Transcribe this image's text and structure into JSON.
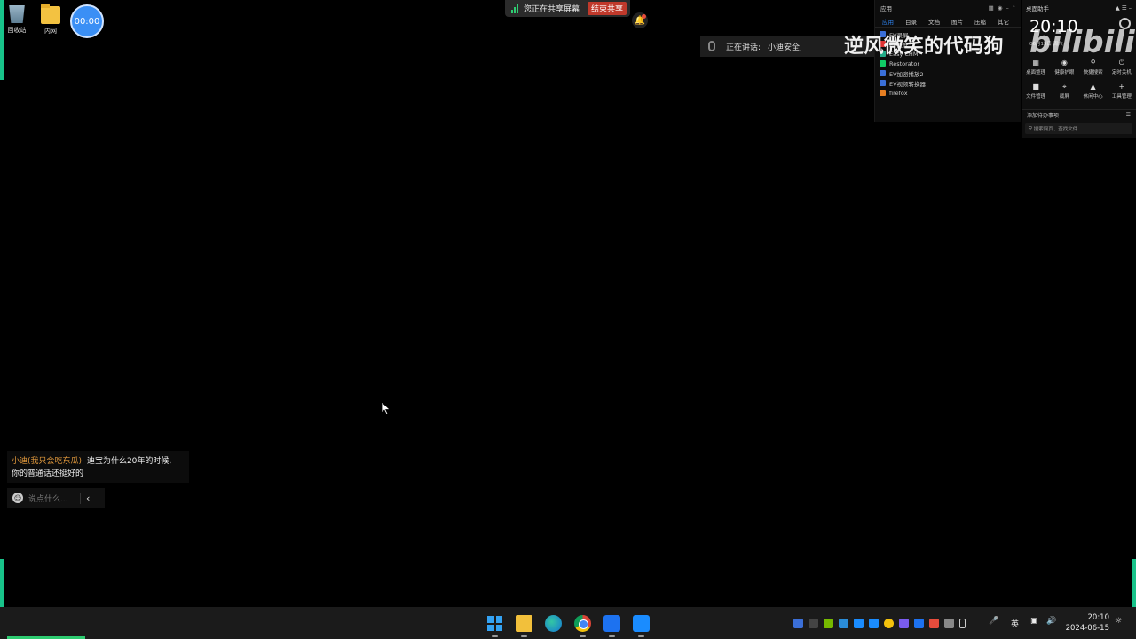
{
  "desktop": {
    "icons": [
      {
        "label": "回收站",
        "icon": "recycle-bin-icon"
      },
      {
        "label": "内网",
        "icon": "folder-icon"
      }
    ],
    "timer": "00:00"
  },
  "share_bar": {
    "status": "您正在共享屏幕",
    "stop_label": "结束共享"
  },
  "speaking": {
    "label": "正在讲话:",
    "speaker": "小迪安全;"
  },
  "watermark": "逆风微笑的代码狗",
  "bilibili_logo": "bilibili",
  "apps_panel": {
    "title": "应用",
    "tabs": [
      "应用",
      "目录",
      "文档",
      "图片",
      "压缩",
      "其它"
    ],
    "items": [
      "EV录屏",
      "EV录屏",
      "Easy CHM",
      "Restorator",
      "EV加密播放2",
      "EV视频转换器",
      "firefox"
    ]
  },
  "assistant": {
    "title": "桌面助手",
    "clock": "20:10",
    "date": "06月15日 周六",
    "tools": [
      {
        "icon": "desktop-organize-icon",
        "label": "桌面整理"
      },
      {
        "icon": "eye-care-icon",
        "label": "健康护眼"
      },
      {
        "icon": "quick-search-icon",
        "label": "快捷搜索"
      },
      {
        "icon": "power-icon",
        "label": "定时关机"
      },
      {
        "icon": "folder-icon",
        "label": "文件管理"
      },
      {
        "icon": "screenshot-icon",
        "label": "截屏"
      },
      {
        "icon": "gamepad-icon",
        "label": "休闲中心"
      },
      {
        "icon": "plus-icon",
        "label": "工具管理"
      }
    ],
    "todo": "添加待办事项",
    "search_placeholder": "搜索网页、查找文件"
  },
  "chat": {
    "user": "小迪(我只会吃东瓜):",
    "message_line1": "迪宝为什么20年的时候,",
    "message_line2": "你的普通话还挺好的",
    "input_placeholder": "说点什么..."
  },
  "taskbar": {
    "apps": [
      "start-menu",
      "file-explorer",
      "edge",
      "chrome",
      "app-cross",
      "meeting-app"
    ],
    "ime": "英",
    "time": "20:10",
    "date": "2024-06-15",
    "progress": 0.07
  },
  "colors": {
    "accent_green": "#18c38a",
    "stop_red": "#c0392b",
    "chat_user": "#e39a3d",
    "tab_active": "#2f86f6"
  }
}
